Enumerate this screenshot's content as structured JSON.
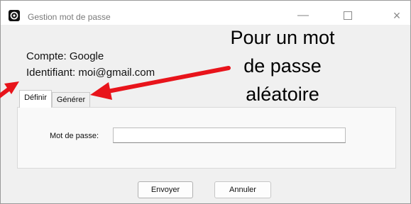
{
  "window": {
    "title": "Gestion mot de passe",
    "controls": {
      "minimize": "—",
      "close": "×"
    }
  },
  "account": {
    "compte": "Compte: Google",
    "identifiant": "Identifiant: moi@gmail.com"
  },
  "tabs": [
    {
      "label": "Définir",
      "active": true
    },
    {
      "label": "Générer",
      "active": false
    }
  ],
  "form": {
    "password_label": "Mot de passe:",
    "password_value": ""
  },
  "buttons": {
    "send": "Envoyer",
    "cancel": "Annuler"
  },
  "annotation": {
    "lines": [
      "Pour un mot",
      "de passe",
      "aléatoire"
    ],
    "arrow_color": "#e8141b"
  }
}
